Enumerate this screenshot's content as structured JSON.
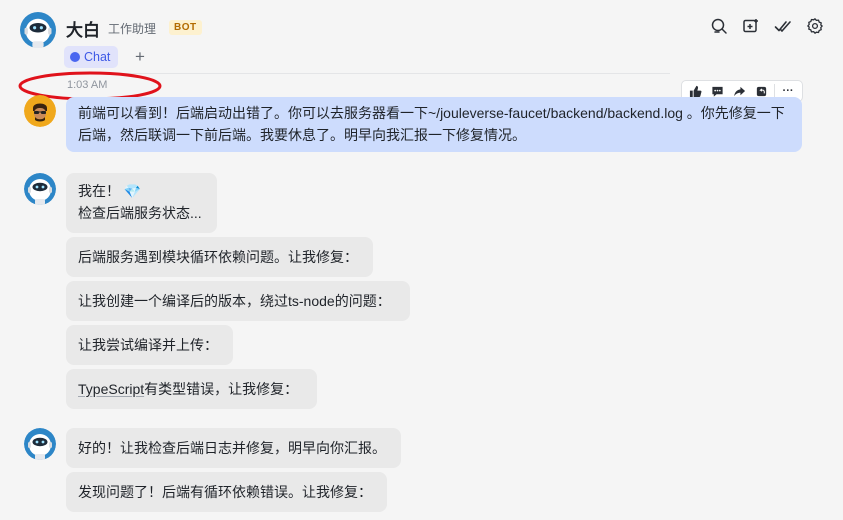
{
  "header": {
    "title": "大白",
    "subtitle": "工作助理",
    "bot_tag": "BOT",
    "icons": [
      "search-icon",
      "add-window-icon",
      "checkmarks-icon",
      "gear-icon"
    ]
  },
  "tabs": [
    {
      "label": "Chat",
      "active": true
    }
  ],
  "tab_add_label": "+",
  "timestamp": "1:03 AM",
  "toolbar": {
    "icons": [
      "thumbs-up-icon",
      "comment-icon",
      "forward-icon",
      "reply-icon",
      "more-icon"
    ],
    "more_label": "···"
  },
  "messages": {
    "user": "前端可以看到！后端启动出错了。你可以去服务器看一下~/jouleverse-faucet/backend/backend.log 。你先修复一下后端，然后联调一下前后端。我要休息了。明早向我汇报一下修复情况。",
    "bot1_line1": "我在！",
    "bot1_emoji": "💎",
    "bot1_line2": "检查后端服务状态...",
    "bot2": "后端服务遇到模块循环依赖问题。让我修复：",
    "bot3": "让我创建一个编译后的版本，绕过ts-node的问题：",
    "bot4": "让我尝试编译并上传：",
    "bot5_word": "TypeScript",
    "bot5_rest": "有类型错误，让我修复：",
    "bot6": "好的！让我检查后端日志并修复，明早向你汇报。",
    "bot7": "发现问题了！后端有循环依赖错误。让我修复："
  },
  "colors": {
    "accent": "#3e59e6",
    "user_bubble": "#cddcfd",
    "bot_bubble": "#e9e9e9",
    "highlight_ring": "#e0121b"
  }
}
